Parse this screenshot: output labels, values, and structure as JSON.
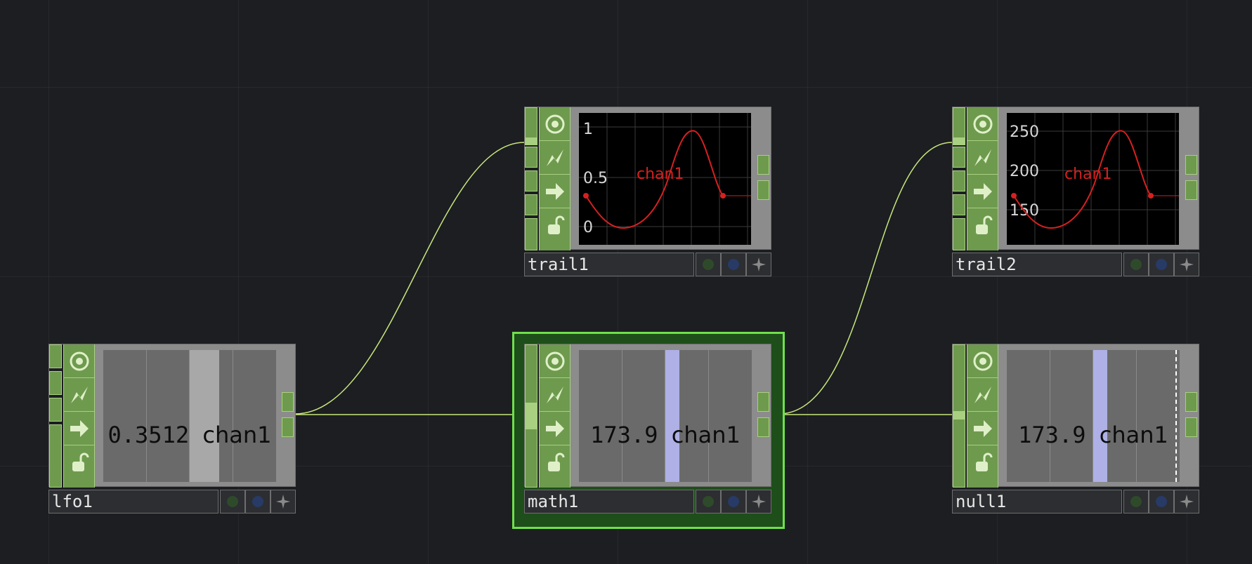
{
  "nodes": {
    "lfo1": {
      "name": "lfo1",
      "value": "0.3512",
      "channel": "chan1"
    },
    "trail1": {
      "name": "trail1",
      "channel": "chan1",
      "yticks": [
        "1",
        "0.5",
        "0"
      ]
    },
    "trail2": {
      "name": "trail2",
      "channel": "chan1",
      "yticks": [
        "250",
        "200",
        "150"
      ]
    },
    "math1": {
      "name": "math1",
      "value": "173.9",
      "channel": "chan1",
      "selected": true
    },
    "null1": {
      "name": "null1",
      "value": "173.9",
      "channel": "chan1"
    }
  },
  "flag_icons": [
    "viewer-icon",
    "cook-icon",
    "arrow-icon",
    "lock-icon"
  ],
  "footer_icons": [
    "bypass-icon",
    "display-icon",
    "pin-icon"
  ],
  "colors": {
    "background": "#1c1e22",
    "node_green": "#6e9a4e",
    "wire": "#c8e67a",
    "selection": "#6fe04a",
    "trail_curve": "#d62020",
    "cursor_lavender": "#aeb0e6",
    "cursor_grey": "#a8a8a8"
  }
}
